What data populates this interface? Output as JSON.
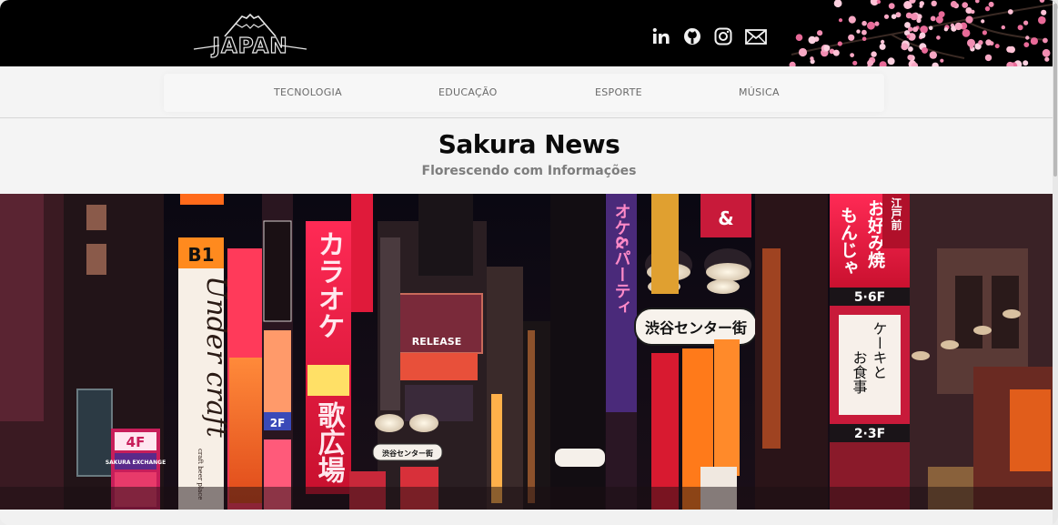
{
  "header": {
    "logo_text": "JAPAN",
    "social": [
      {
        "name": "linkedin-icon"
      },
      {
        "name": "github-icon"
      },
      {
        "name": "instagram-icon"
      },
      {
        "name": "mail-icon"
      }
    ]
  },
  "nav": {
    "items": [
      {
        "label": "TECNOLOGIA"
      },
      {
        "label": "EDUCAÇÃO"
      },
      {
        "label": "ESPORTE"
      },
      {
        "label": "MÚSICA"
      }
    ]
  },
  "site": {
    "title": "Sakura News",
    "subtitle": "Florescendo com Informações"
  },
  "hero": {
    "image_alt": "Rua iluminada por letreiros de neon em Tóquio",
    "signs": {
      "b1": "B1",
      "under_craft": "Under craft",
      "craft_beer_place": "craft beer place",
      "karaoke": "カラオケ",
      "kabuhiroba": "歌広場",
      "release": "RELEASE",
      "shibuya": "渋谷センター街",
      "okonomiyaki": "お好み焼もんじゃ",
      "cake": "ケーキとお食事",
      "f56": "5·6F",
      "f23": "2·3F",
      "f4": "4F",
      "f2": "2F",
      "sakura_exchange": "SAKURA EXCHANGE",
      "edo": "江戸前"
    }
  },
  "colors": {
    "header_bg": "#000000",
    "nav_text": "#6a6a6a",
    "title": "#0a0a0a",
    "subtitle": "#7d7d7d"
  }
}
